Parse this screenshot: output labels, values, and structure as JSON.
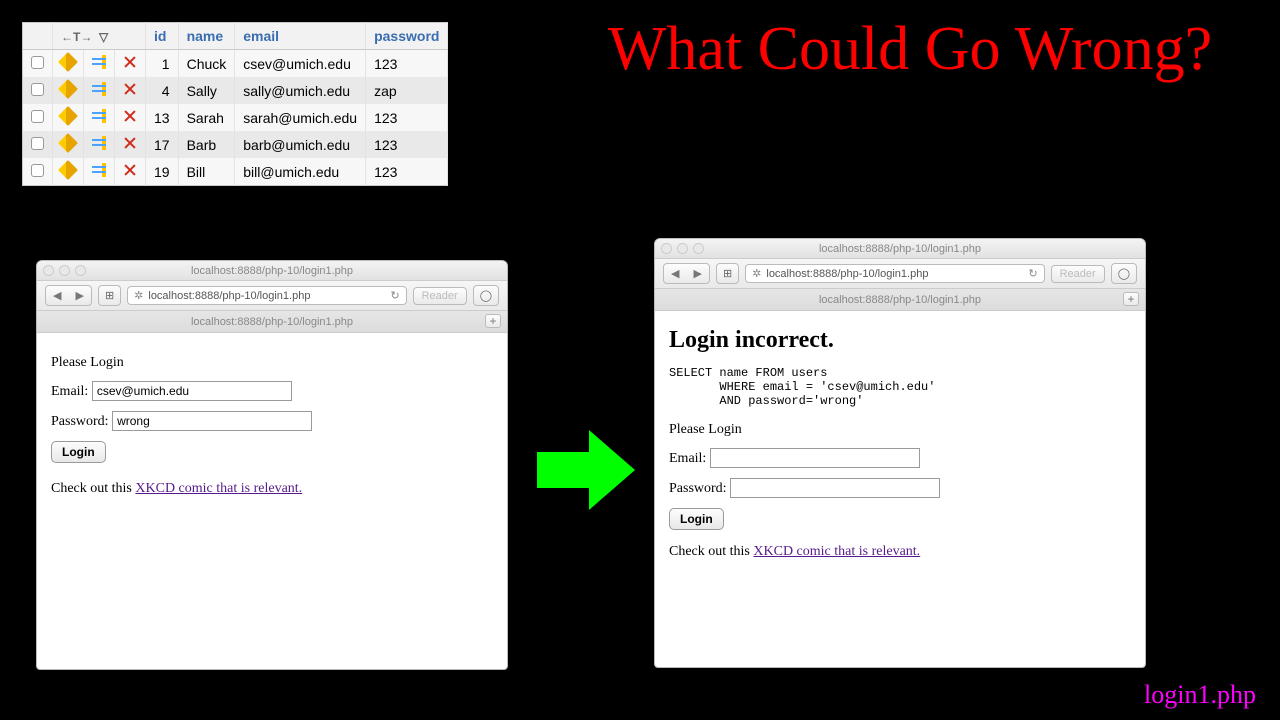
{
  "title": "What Could Go Wrong?",
  "footer_label": "login1.php",
  "db": {
    "columns": [
      "id",
      "name",
      "email",
      "password"
    ],
    "rows": [
      {
        "id": "1",
        "name": "Chuck",
        "email": "csev@umich.edu",
        "password": "123"
      },
      {
        "id": "4",
        "name": "Sally",
        "email": "sally@umich.edu",
        "password": "zap"
      },
      {
        "id": "13",
        "name": "Sarah",
        "email": "sarah@umich.edu",
        "password": "123"
      },
      {
        "id": "17",
        "name": "Barb",
        "email": "barb@umich.edu",
        "password": "123"
      },
      {
        "id": "19",
        "name": "Bill",
        "email": "bill@umich.edu",
        "password": "123"
      }
    ]
  },
  "browser_left": {
    "window_title": "localhost:8888/php-10/login1.php",
    "url": "localhost:8888/php-10/login1.php",
    "tab": "localhost:8888/php-10/login1.php",
    "reader": "Reader",
    "page": {
      "please_login": "Please Login",
      "email_label": "Email:",
      "email_value": "csev@umich.edu",
      "password_label": "Password:",
      "password_value": "wrong",
      "login_btn": "Login",
      "footer_text": "Check out this ",
      "footer_link": "XKCD comic that is relevant.",
      "footer_period": ""
    }
  },
  "browser_right": {
    "window_title": "localhost:8888/php-10/login1.php",
    "url": "localhost:8888/php-10/login1.php",
    "tab": "localhost:8888/php-10/login1.php",
    "reader": "Reader",
    "page": {
      "heading": "Login incorrect.",
      "sql": "SELECT name FROM users\n       WHERE email = 'csev@umich.edu'\n       AND password='wrong'",
      "please_login": "Please Login",
      "email_label": "Email:",
      "email_value": "",
      "password_label": "Password:",
      "password_value": "",
      "login_btn": "Login",
      "footer_text": "Check out this ",
      "footer_link": "XKCD comic that is relevant."
    }
  }
}
